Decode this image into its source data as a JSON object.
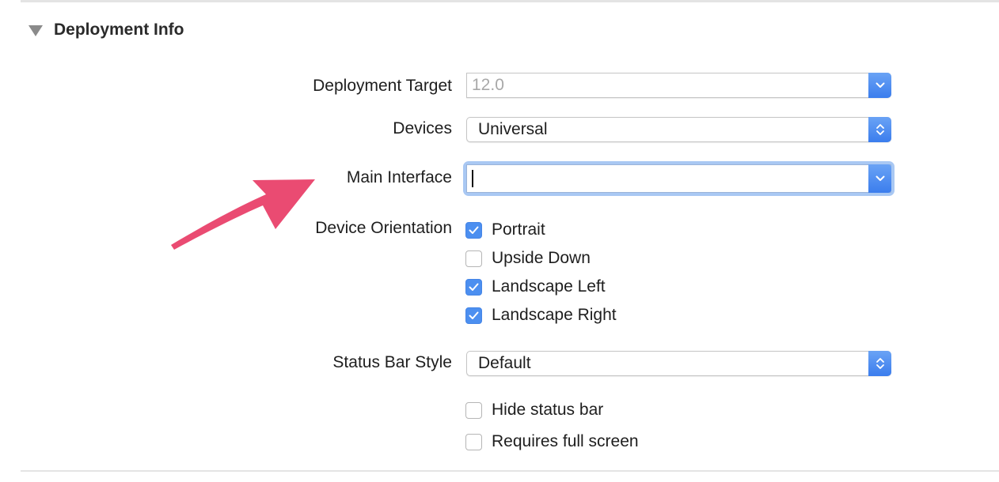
{
  "section": {
    "title": "Deployment Info",
    "expanded": true
  },
  "fields": {
    "deployment_target": {
      "label": "Deployment Target",
      "value": "12.0",
      "enabled": false
    },
    "devices": {
      "label": "Devices",
      "value": "Universal"
    },
    "main_interface": {
      "label": "Main Interface",
      "value": ""
    },
    "device_orientation": {
      "label": "Device Orientation",
      "options": [
        {
          "label": "Portrait",
          "checked": true
        },
        {
          "label": "Upside Down",
          "checked": false
        },
        {
          "label": "Landscape Left",
          "checked": true
        },
        {
          "label": "Landscape Right",
          "checked": true
        }
      ]
    },
    "status_bar_style": {
      "label": "Status Bar Style",
      "value": "Default"
    },
    "hide_status_bar": {
      "label": "Hide status bar",
      "checked": false
    },
    "requires_full_screen": {
      "label": "Requires full screen",
      "checked": false
    }
  },
  "annotation": {
    "type": "arrow",
    "color": "#ea4b72",
    "points_to": "Main Interface"
  },
  "colors": {
    "accent": "#3b7ded",
    "focus_ring": "#a9c8f3",
    "checkbox_on": "#4c8ff0"
  }
}
